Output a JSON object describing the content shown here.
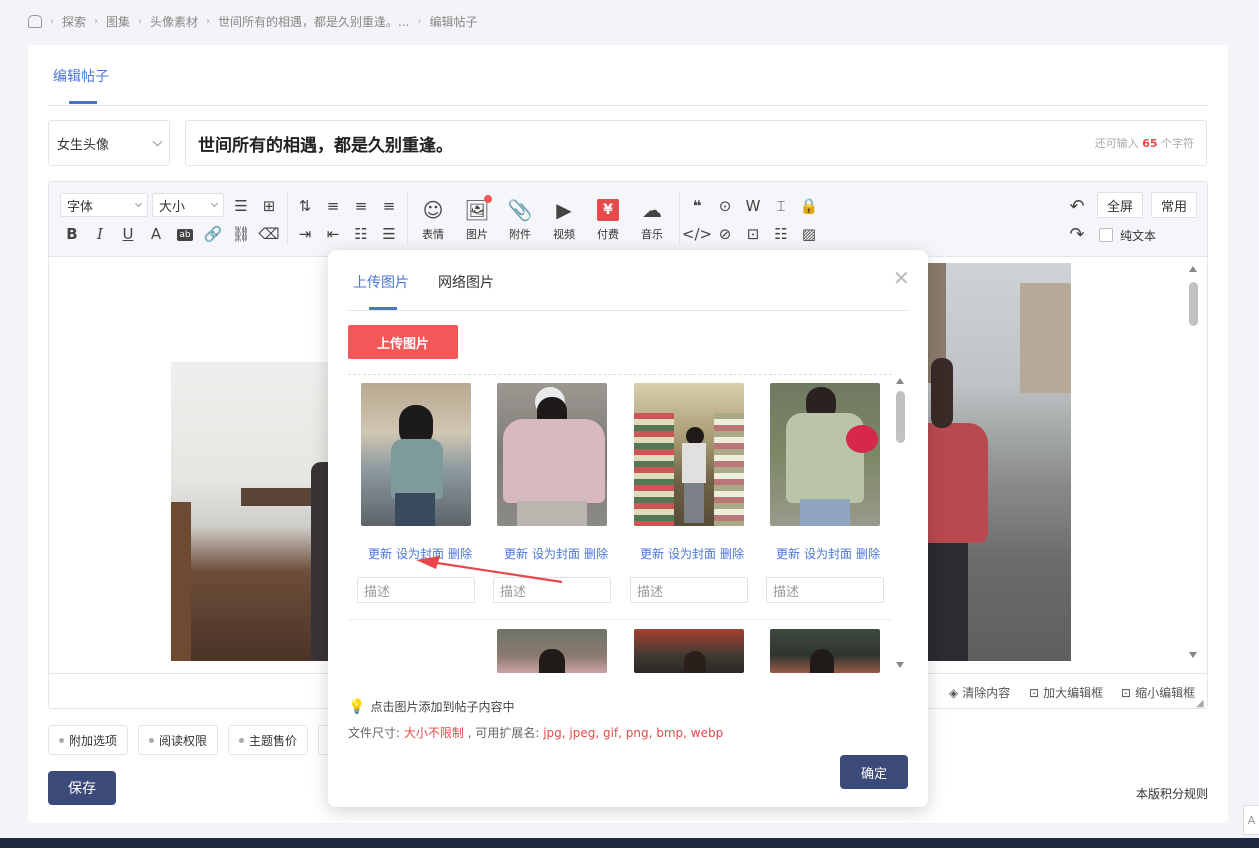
{
  "breadcrumb": {
    "items": [
      "探索",
      "图集",
      "头像素材",
      "世间所有的相遇，都是久别重逢。...",
      "编辑帖子"
    ]
  },
  "page": {
    "tab_label": "编辑帖子",
    "category": "女生头像",
    "title": "世间所有的相遇，都是久别重逢。",
    "count_prefix": "还可输入",
    "count_value": "65",
    "count_suffix": "个字符"
  },
  "toolbar": {
    "font_select": "字体",
    "size_select": "大小",
    "big_buttons": [
      "表情",
      "图片",
      "附件",
      "视频",
      "付费",
      "音乐"
    ],
    "fullscreen": "全屏",
    "common": "常用",
    "plain_text": "纯文本",
    "pay_symbol": "¥"
  },
  "editor_footer": {
    "clear": "清除内容",
    "enlarge": "加大编辑框",
    "shrink": "缩小编辑框"
  },
  "options": {
    "tags": [
      "附加选项",
      "阅读权限",
      "主题售价"
    ],
    "save": "保存",
    "rules": "本版积分规则"
  },
  "modal": {
    "tabs": [
      "上传图片",
      "网络图片"
    ],
    "upload_button": "上传图片",
    "actions": {
      "update": "更新",
      "set_cover": "设为封面",
      "delete": "删除"
    },
    "desc_placeholder": "描述",
    "tip_click": "点击图片添加到帖子内容中",
    "size_label": "文件尺寸: ",
    "size_value": "大小不限制",
    "ext_label": " , 可用扩展名: ",
    "ext_value": "jpg, jpeg, gif, png, bmp, webp",
    "confirm": "确定"
  },
  "colors": {
    "accent": "#4b74d9",
    "primary_button": "#3c4a7a",
    "upload_red": "#f35757",
    "arrow_red": "#e8464a"
  }
}
